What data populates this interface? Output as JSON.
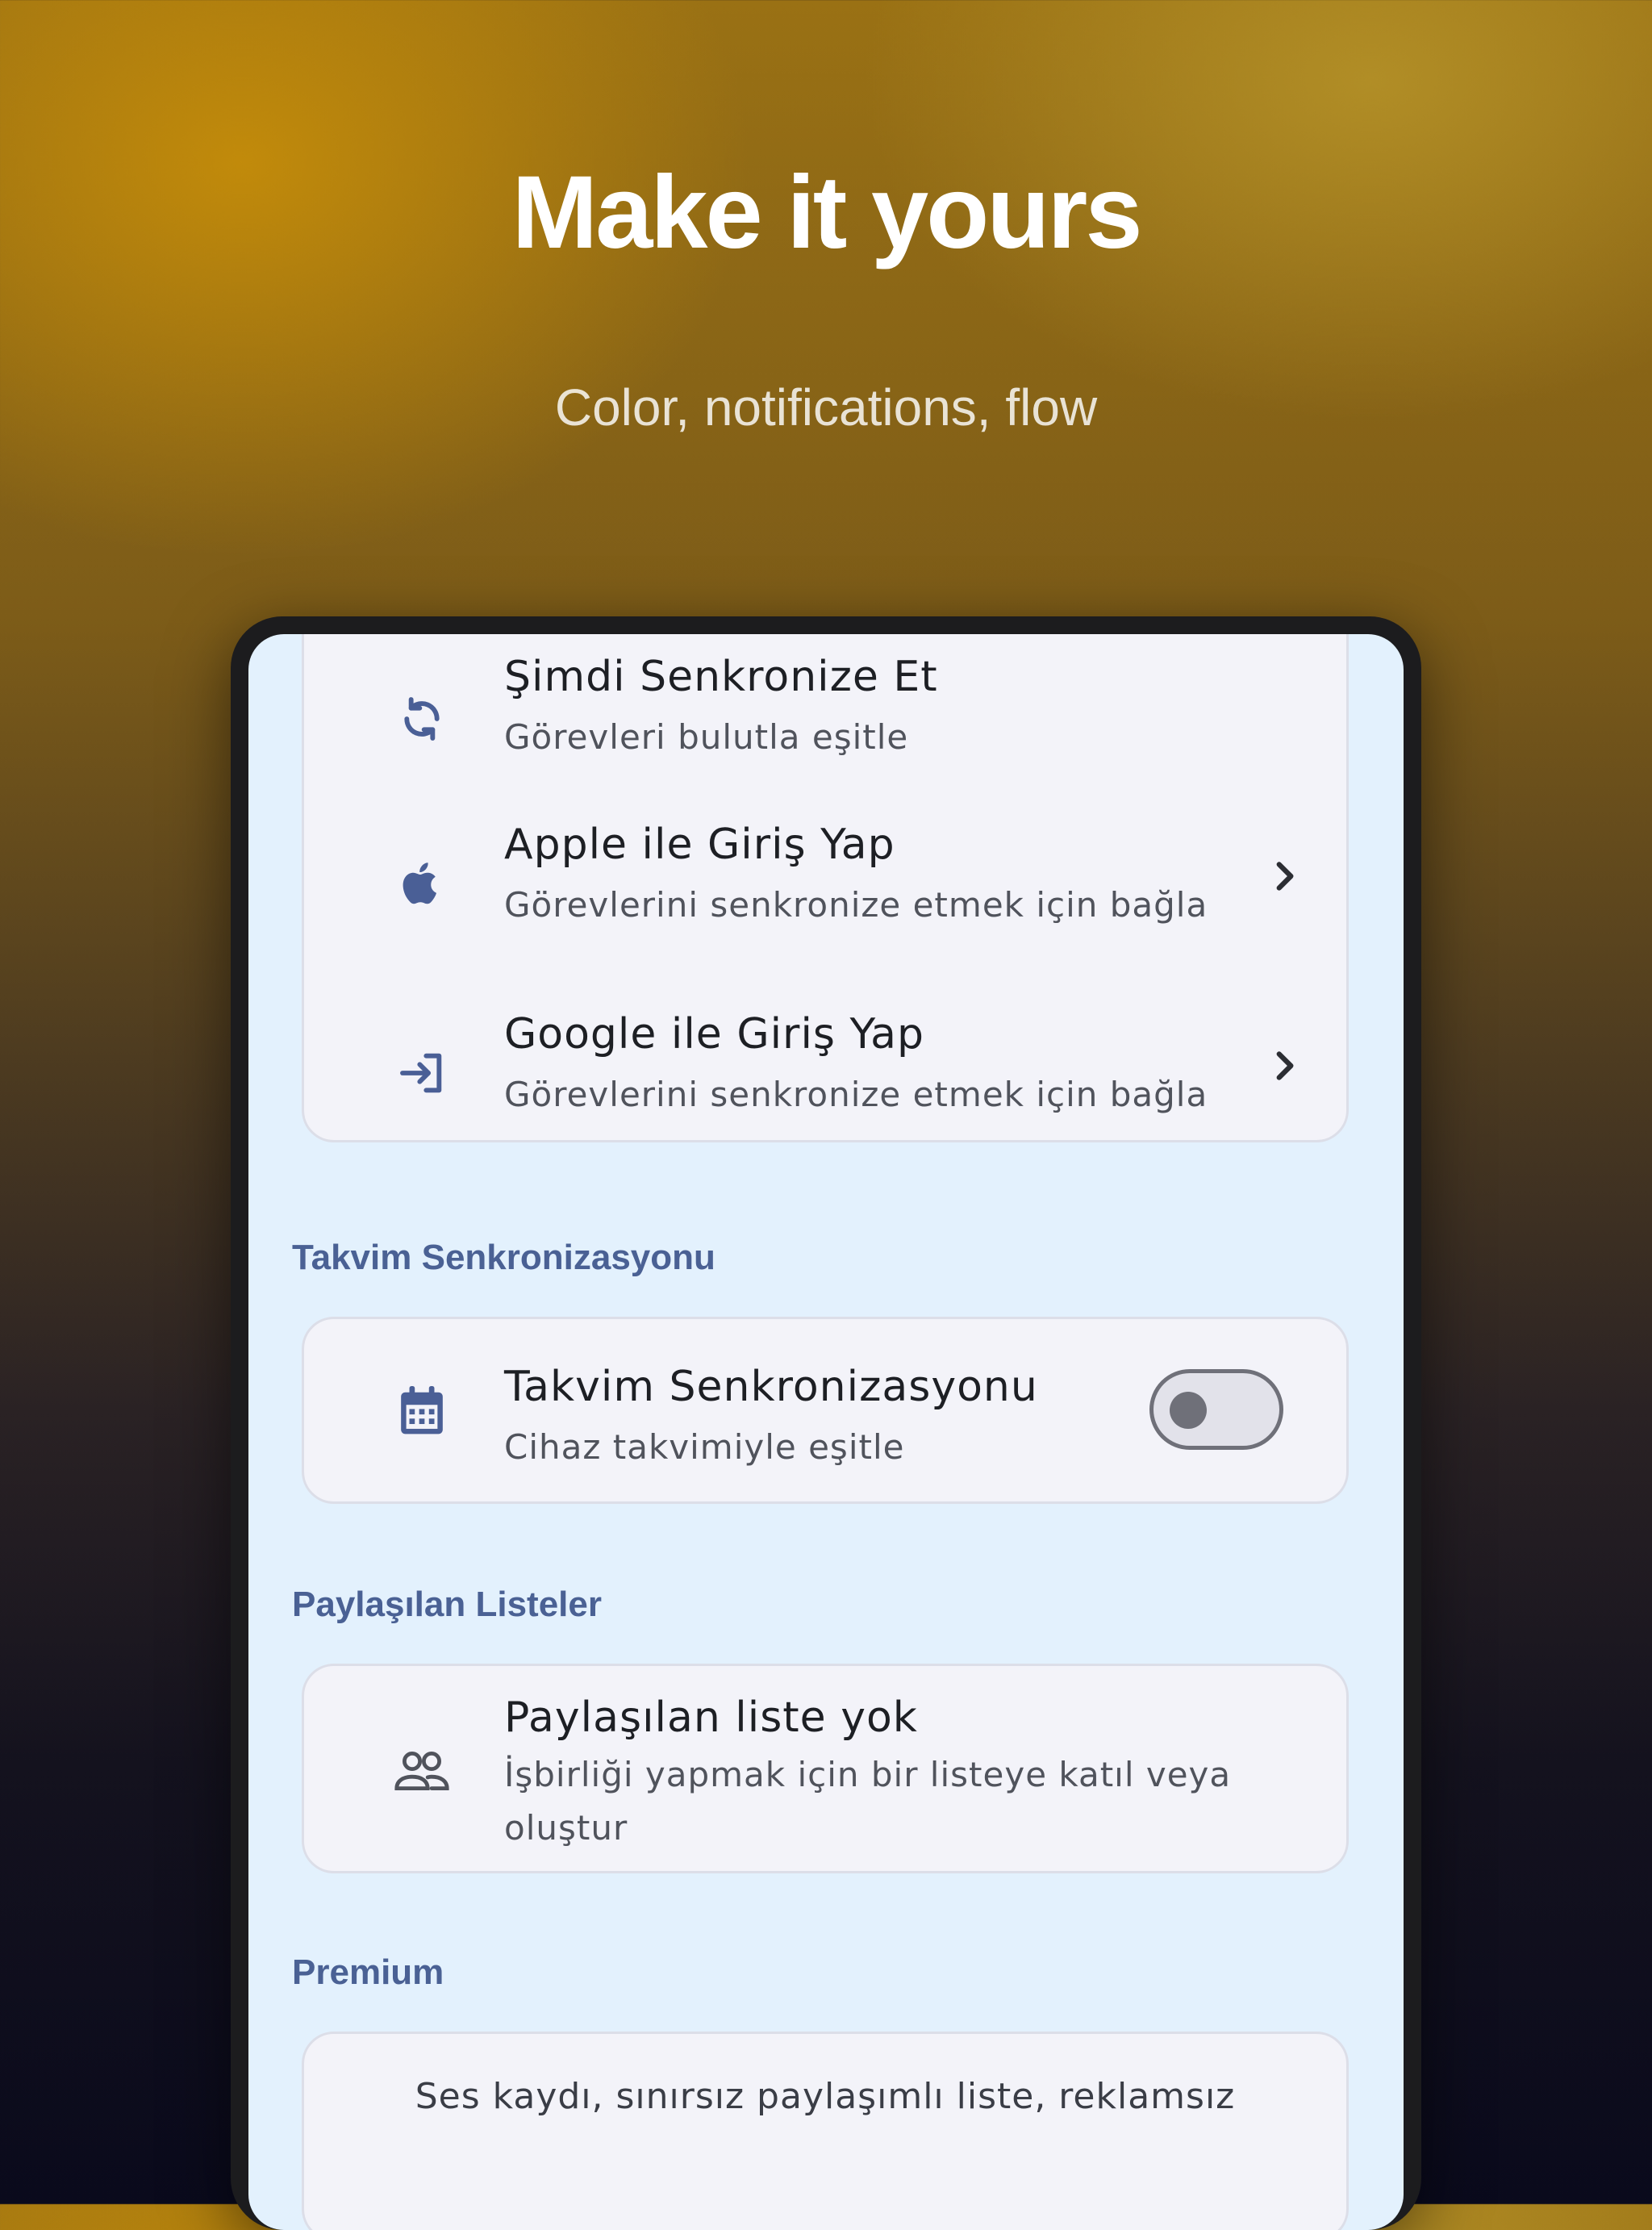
{
  "hero": {
    "title": "Make it yours",
    "subtitle": "Color, notifications, flow"
  },
  "account_card": {
    "items": [
      {
        "icon": "sync-icon",
        "title": "Şimdi Senkronize Et",
        "subtitle": "Görevleri bulutla eşitle",
        "has_chevron": false
      },
      {
        "icon": "apple-icon",
        "title": "Apple ile Giriş Yap",
        "subtitle": "Görevlerini senkronize etmek için bağla",
        "has_chevron": true
      },
      {
        "icon": "login-icon",
        "title": "Google ile Giriş Yap",
        "subtitle": "Görevlerini senkronize etmek için bağla",
        "has_chevron": true
      }
    ]
  },
  "calendar_section": {
    "header": "Takvim Senkronizasyonu",
    "item": {
      "icon": "calendar-icon",
      "title": "Takvim Senkronizasyonu",
      "subtitle": "Cihaz takvimiyle eşitle",
      "toggle_on": false
    }
  },
  "shared_section": {
    "header": "Paylaşılan Listeler",
    "item": {
      "icon": "people-icon",
      "title": "Paylaşılan liste yok",
      "subtitle": "İşbirliği yapmak için bir listeye katıl veya oluştur"
    }
  },
  "premium_section": {
    "header": "Premium",
    "text": "Ses kaydı, sınırsız paylaşımlı liste, reklamsız"
  },
  "colors": {
    "accent": "#4a6194",
    "screen_bg": "#e3f1fd",
    "card_bg": "#f3f3f9",
    "icon": "#4a5f96"
  }
}
